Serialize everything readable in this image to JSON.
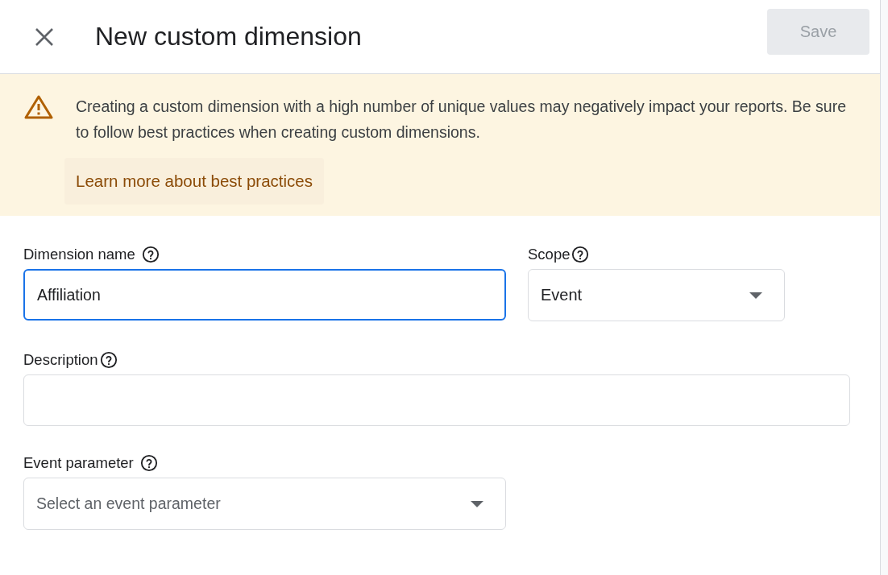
{
  "header": {
    "title": "New custom dimension",
    "save_button": {
      "label": "Save",
      "disabled": true
    }
  },
  "banner": {
    "message": "Creating a custom dimension with a high number of unique values may negatively impact your reports. Be sure to follow best practices when creating custom dimensions.",
    "link": "Learn more about best practices"
  },
  "form": {
    "dimension_name": {
      "label": "Dimension name",
      "value": "Affiliation",
      "focused": true
    },
    "scope": {
      "label": "Scope",
      "value": "Event"
    },
    "description": {
      "label": "Description",
      "focused": false
    },
    "event_parameter": {
      "label": "Event parameter",
      "placeholder": "Select an event parameter"
    }
  }
}
